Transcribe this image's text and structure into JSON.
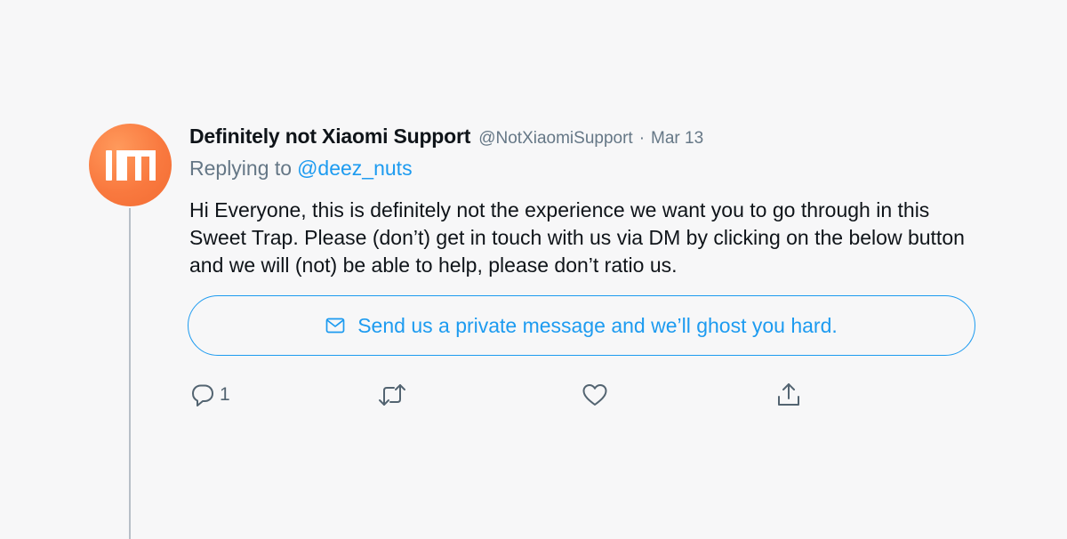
{
  "tweet": {
    "display_name": "Definitely not Xiaomi Support",
    "handle": "@NotXiaomiSupport",
    "separator": "·",
    "date": "Mar 13",
    "replying_prefix": "Replying to",
    "replying_to": "@deez_nuts",
    "text": "Hi Everyone, this is definitely not the experience we want you to go through in this Sweet Trap. Please (don’t) get in touch with us via DM by clicking on the below button and we will (not) be able to help, please don’t ratio us.",
    "dm_button_label": "Send us a private message and we’ll ghost you hard."
  },
  "actions": {
    "reply_count": "1",
    "icons": [
      "reply-icon",
      "retweet-icon",
      "like-icon",
      "share-icon"
    ]
  },
  "colors": {
    "accent": "#1d9bf0",
    "avatar": "#f9793f",
    "muted": "#657786",
    "background": "#f7f7f8"
  }
}
